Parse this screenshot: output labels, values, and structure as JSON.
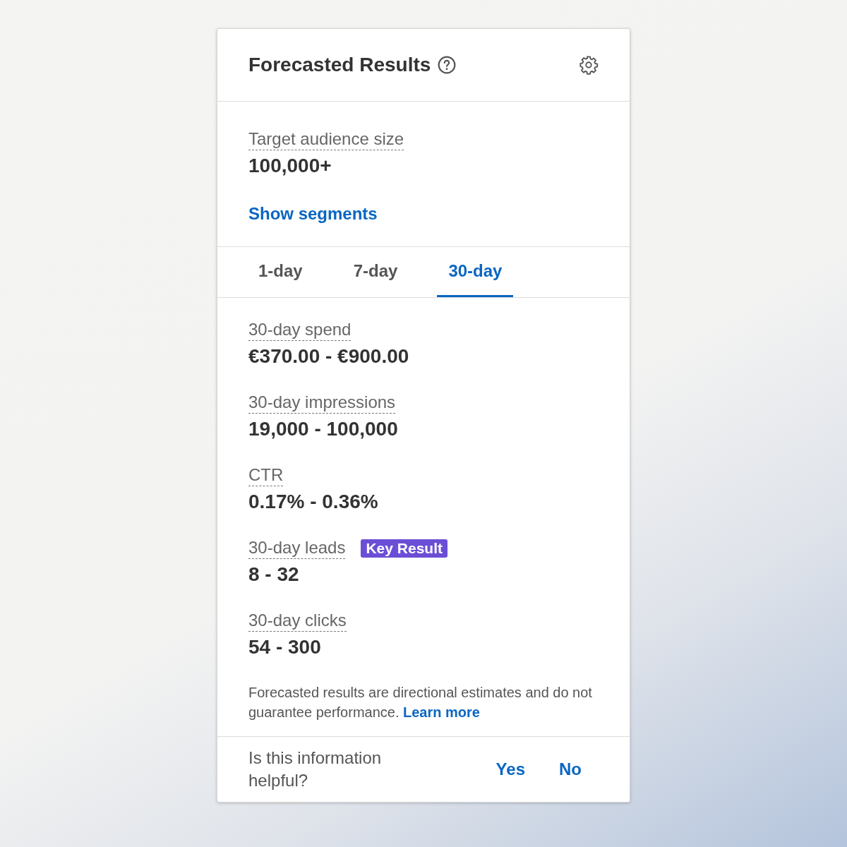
{
  "header": {
    "title": "Forecasted Results"
  },
  "audience": {
    "label": "Target audience size",
    "value": "100,000+",
    "link": "Show segments"
  },
  "tabs": [
    {
      "label": "1-day",
      "selected": false
    },
    {
      "label": "7-day",
      "selected": false
    },
    {
      "label": "30-day",
      "selected": true
    }
  ],
  "metrics": [
    {
      "label": "30-day spend",
      "value": "€370.00 - €900.00"
    },
    {
      "label": "30-day impressions",
      "value": "19,000 - 100,000"
    },
    {
      "label": "CTR",
      "value": "0.17% - 0.36%"
    },
    {
      "label": "30-day leads",
      "value": "8 - 32",
      "badge": "Key Result"
    },
    {
      "label": "30-day clicks",
      "value": "54 - 300"
    }
  ],
  "disclaimer": {
    "text": "Forecasted results are directional estimates and do not guarantee performance.",
    "link": "Learn more"
  },
  "feedback": {
    "question": "Is this information helpful?",
    "buttons": [
      "Yes",
      "No"
    ]
  }
}
